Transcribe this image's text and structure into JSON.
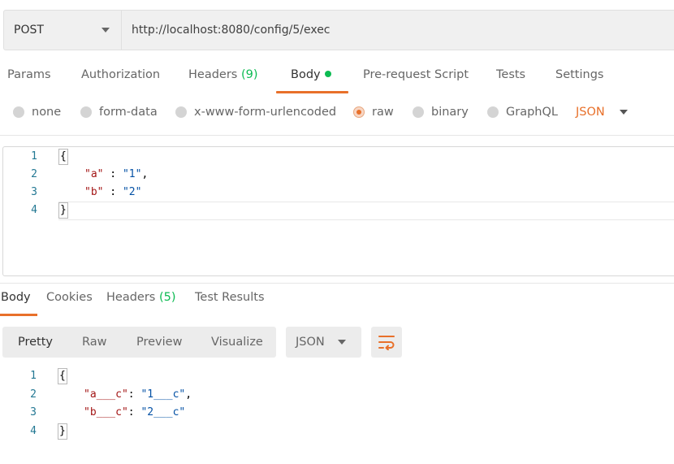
{
  "request": {
    "method": "POST",
    "url": "http://localhost:8080/config/5/exec"
  },
  "request_tabs": [
    {
      "label": "Params"
    },
    {
      "label": "Authorization"
    },
    {
      "label": "Headers",
      "count": "(9)"
    },
    {
      "label": "Body",
      "active": true
    },
    {
      "label": "Pre-request Script"
    },
    {
      "label": "Tests"
    },
    {
      "label": "Settings"
    }
  ],
  "body_types": {
    "options": [
      "none",
      "form-data",
      "x-www-form-urlencoded",
      "raw",
      "binary",
      "GraphQL"
    ],
    "selected": "raw",
    "format": "JSON"
  },
  "request_body": {
    "line_numbers": [
      "1",
      "2",
      "3",
      "4"
    ],
    "open_brace": "{",
    "close_brace": "}",
    "entries": [
      {
        "key": "\"a\"",
        "sep": " : ",
        "value": "\"1\"",
        "trail": ","
      },
      {
        "key": "\"b\"",
        "sep": " : ",
        "value": "\"2\"",
        "trail": ""
      }
    ]
  },
  "response_tabs": [
    {
      "label": "Body",
      "active": true
    },
    {
      "label": "Cookies"
    },
    {
      "label": "Headers",
      "count": "(5)"
    },
    {
      "label": "Test Results"
    }
  ],
  "response_view": {
    "modes": [
      "Pretty",
      "Raw",
      "Preview",
      "Visualize"
    ],
    "active_mode": "Pretty",
    "format": "JSON",
    "wrap_icon": "wrap-lines-icon"
  },
  "response_body": {
    "line_numbers": [
      "1",
      "2",
      "3",
      "4"
    ],
    "open_brace": "{",
    "close_brace": "}",
    "entries": [
      {
        "key": "\"a___c\"",
        "sep": ": ",
        "value": "\"1___c\"",
        "trail": ","
      },
      {
        "key": "\"b___c\"",
        "sep": ": ",
        "value": "\"2___c\"",
        "trail": ""
      }
    ]
  },
  "colors": {
    "accent": "#e8702a",
    "count_green": "#0cbb52",
    "json_key": "#a31515",
    "json_value": "#0451a5",
    "line_number": "#237893"
  }
}
